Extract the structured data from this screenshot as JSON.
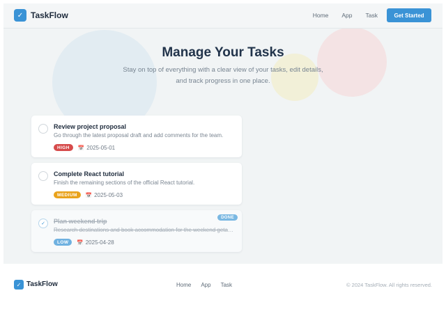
{
  "brand": "TaskFlow",
  "logo_icon": "check-icon",
  "logo_glyph": "✓",
  "nav": {
    "links": [
      "Home",
      "App",
      "Task"
    ],
    "cta": "Get Started"
  },
  "hero": {
    "title": "Manage Your Tasks",
    "subtitle_line1": "Stay on top of everything with a clear view of your tasks, edit details,",
    "subtitle_line2": "and track progress in one place."
  },
  "tasks": [
    {
      "title": "Review project proposal",
      "description": "Go through the latest proposal draft and add comments for the team.",
      "priority": "HIGH",
      "date": "2025-05-01",
      "completed": false,
      "check_glyph": ""
    },
    {
      "title": "Complete React tutorial",
      "description": "Finish the remaining sections of the official React tutorial.",
      "priority": "MEDIUM",
      "date": "2025-05-03",
      "completed": false,
      "check_glyph": ""
    },
    {
      "title": "Plan weekend trip",
      "description": "Research destinations and book accommodation for the weekend getaway.",
      "priority": "LOW",
      "date": "2025-04-28",
      "completed": true,
      "check_glyph": "✓",
      "status_label": "DONE"
    }
  ],
  "calendar_icon": "calendar-icon",
  "calendar_glyph": "📅",
  "colors": {
    "accent": "#3a93d6",
    "high": "#d64b4b",
    "medium": "#e9a21b",
    "low": "#6fb1e0",
    "done": "#7ab8e2"
  },
  "footer": {
    "brand": "TaskFlow",
    "links": [
      "Home",
      "App",
      "Task"
    ],
    "copyright": "© 2024 TaskFlow. All rights reserved."
  }
}
